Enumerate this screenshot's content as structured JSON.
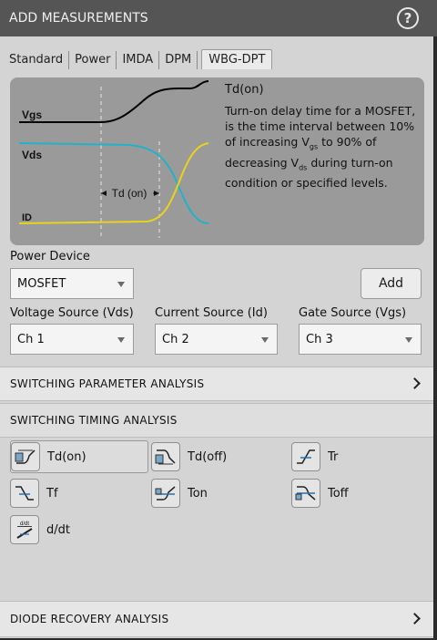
{
  "title": "ADD MEASUREMENTS",
  "help_glyph": "?",
  "tabs": [
    "Standard",
    "Power",
    "IMDA",
    "DPM",
    "WBG-DPT"
  ],
  "active_tab": "WBG-DPT",
  "diagram": {
    "signals": [
      "Vgs",
      "Vds",
      "ID"
    ],
    "interval_label": "Td (on)",
    "desc_title": "Td(on)",
    "desc": {
      "p1": "Turn-on delay time for a MOSFET, is the time interval between 10% of increasing V",
      "sub1": "gs",
      "p2": " to 90% of decreasing V",
      "sub2": "ds",
      "p3": " during turn-on condition or specified levels."
    },
    "colors": {
      "vgs": "#000000",
      "vds": "#22b2c8",
      "id": "#e8d21a"
    }
  },
  "power_device": {
    "label": "Power Device",
    "value": "MOSFET"
  },
  "add_label": "Add",
  "voltage_source": {
    "label": "Voltage Source (Vds)",
    "value": "Ch 1"
  },
  "current_source": {
    "label": "Current Source (Id)",
    "value": "Ch 2"
  },
  "gate_source": {
    "label": "Gate Source (Vgs)",
    "value": "Ch 3"
  },
  "sections": {
    "switching_param": "SWITCHING PARAMETER ANALYSIS",
    "switching_timing": "SWITCHING TIMING ANALYSIS",
    "diode_recovery": "DIODE RECOVERY ANALYSIS"
  },
  "measurements": [
    {
      "label": "Td(on)",
      "icon": "td-on-icon",
      "selected": true
    },
    {
      "label": "Td(off)",
      "icon": "td-off-icon",
      "selected": false
    },
    {
      "label": "Tr",
      "icon": "tr-icon",
      "selected": false
    },
    {
      "label": "Tf",
      "icon": "tf-icon",
      "selected": false
    },
    {
      "label": "Ton",
      "icon": "ton-icon",
      "selected": false
    },
    {
      "label": "Toff",
      "icon": "toff-icon",
      "selected": false
    },
    {
      "label": "d/dt",
      "icon": "d-dt-icon",
      "selected": false
    }
  ],
  "ddt_icon_text": "d/dt"
}
